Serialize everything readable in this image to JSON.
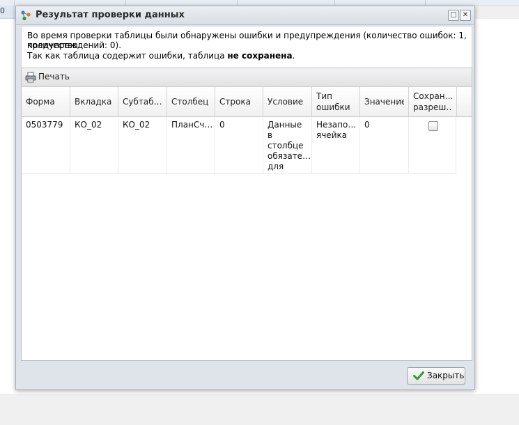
{
  "background": {
    "left_cell_value": "0"
  },
  "dialog": {
    "title": "Результат проверки данных",
    "maximize_glyph": "□",
    "close_glyph": "✕",
    "message": {
      "line1": "Во время проверки таблицы были обнаружены ошибки и предупреждения (количество ошибок: 1, количество",
      "line2": "предупреждений: 0).",
      "line3_prefix": "Так как таблица содержит ошибки, таблица ",
      "line3_bold": "не сохранена",
      "line3_suffix": "."
    },
    "toolbar": {
      "print_label": "Печать"
    },
    "table": {
      "headers": [
        "Форма",
        "Вкладка",
        "Субтаб…",
        "Столбец",
        "Строка",
        "Условие",
        "Тип ошибки",
        "Значение",
        "Сохран… разреш…"
      ],
      "rows": [
        {
          "form": "0503779",
          "tab": "КО_02",
          "subtab": "КО_02",
          "column": "ПланСч…",
          "row": "0",
          "condition": "Данные в столбце обязате… для заполне…",
          "error_type": "Незапо… ячейка",
          "value": "0",
          "save_allowed": false
        }
      ]
    },
    "footer": {
      "close_label": "Закрыть"
    }
  },
  "colors": {
    "accent_green": "#2e9e2e",
    "title_icon_blue": "#3d7fc8"
  },
  "icons": [
    "workflow-icon",
    "printer-icon",
    "check-icon",
    "maximize-icon",
    "close-icon"
  ]
}
